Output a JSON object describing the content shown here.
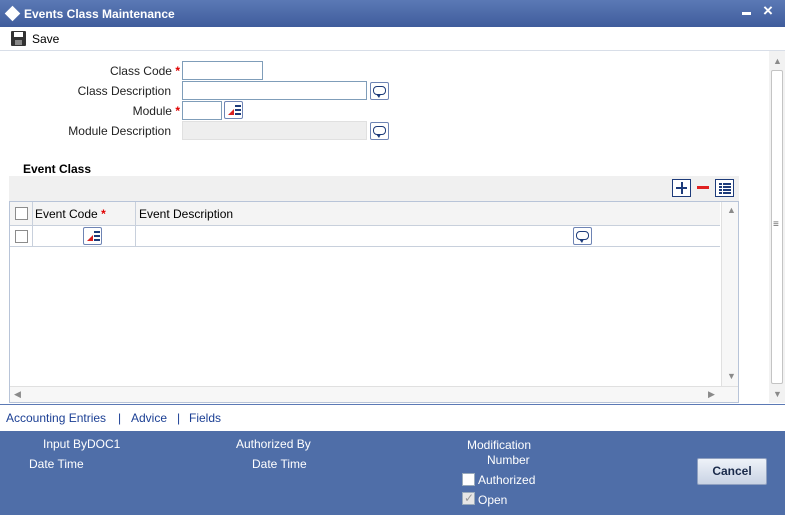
{
  "window": {
    "title": "Events Class Maintenance"
  },
  "toolbar": {
    "save_label": "Save"
  },
  "form": {
    "class_code_label": "Class Code",
    "class_code_value": "",
    "class_description_label": "Class Description",
    "class_description_value": "",
    "module_label": "Module",
    "module_value": "",
    "module_description_label": "Module Description",
    "module_description_value": "",
    "required_mark": "*"
  },
  "event_class": {
    "title": "Event Class",
    "columns": [
      "Event Code",
      "Event Description"
    ],
    "rows": [
      {
        "event_code": "",
        "event_description": ""
      }
    ]
  },
  "links": [
    "Accounting Entries",
    "Advice",
    "Fields"
  ],
  "link_separator": "|",
  "footer": {
    "input_by_label": "Input By",
    "input_by_value": "DOC1",
    "date_time_label": "Date Time",
    "authorized_by_label": "Authorized By",
    "authorized_date_time_label": "Date Time",
    "modification_label": "Modification",
    "number_label": "Number",
    "authorized_label": "Authorized",
    "authorized_checked": false,
    "open_label": "Open",
    "open_checked": true,
    "cancel_label": "Cancel"
  },
  "colors": {
    "titlebar": "#4a68a8",
    "footer": "#4f6ea8",
    "link": "#1b3f94",
    "required": "#e00000"
  }
}
